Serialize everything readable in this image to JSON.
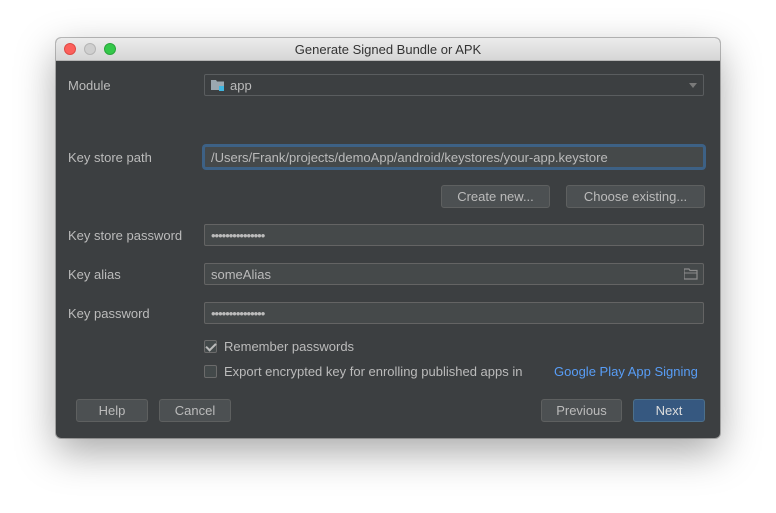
{
  "window": {
    "title": "Generate Signed Bundle or APK"
  },
  "module": {
    "label": "Module",
    "value": "app",
    "icon": "folder-module-icon"
  },
  "keystore": {
    "label": "Key store path",
    "value": "/Users/Frank/projects/demoApp/android/keystores/your-app.keystore",
    "create_label": "Create new...",
    "choose_label": "Choose existing..."
  },
  "keystore_password": {
    "label": "Key store password",
    "value": "•••••••••••••••"
  },
  "key_alias": {
    "label": "Key alias",
    "value": "someAlias",
    "icon": "folder-browse-icon"
  },
  "key_password": {
    "label": "Key password",
    "value": "•••••••••••••••"
  },
  "remember": {
    "label": "Remember passwords",
    "checked": true
  },
  "export": {
    "label": "Export encrypted key for enrolling published apps in",
    "link": "Google Play App Signing",
    "checked": false
  },
  "buttons": {
    "help": "Help",
    "cancel": "Cancel",
    "previous": "Previous",
    "next": "Next"
  },
  "colors": {
    "background": "#3c3f41",
    "field": "#45494a",
    "accent": "#365880",
    "link": "#589df6"
  }
}
